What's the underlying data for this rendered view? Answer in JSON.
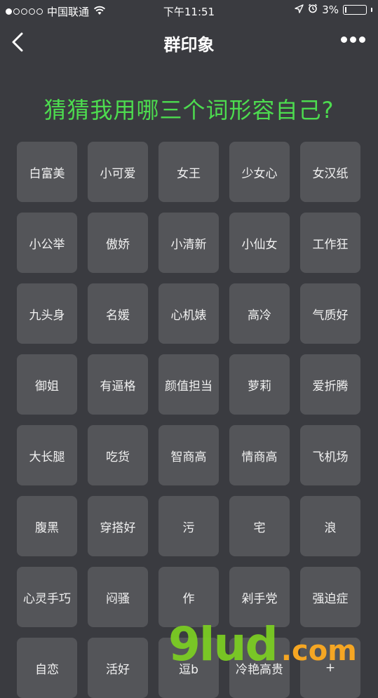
{
  "status_bar": {
    "carrier": "中国联通",
    "time": "下午11:51",
    "battery": "3%",
    "signal_bars_filled": 1,
    "signal_bars_total": 5
  },
  "nav": {
    "title": "群印象",
    "back_icon": "chevron-left-icon",
    "more_icon": "more-dots-icon"
  },
  "question": "猜猜我用哪三个词形容自己?",
  "tags": [
    "白富美",
    "小可爱",
    "女王",
    "少女心",
    "女汉纸",
    "小公举",
    "傲娇",
    "小清新",
    "小仙女",
    "工作狂",
    "九头身",
    "名媛",
    "心机婊",
    "高冷",
    "气质好",
    "御姐",
    "有逼格",
    "颜值担当",
    "萝莉",
    "爱折腾",
    "大长腿",
    "吃货",
    "智商高",
    "情商高",
    "飞机场",
    "腹黑",
    "穿搭好",
    "污",
    "宅",
    "浪",
    "心灵手巧",
    "闷骚",
    "作",
    "剁手党",
    "强迫症",
    "自恋",
    "活好",
    "逗b",
    "冷艳高贵",
    "+"
  ],
  "watermark": {
    "main": "9lud",
    "tld": ".com"
  },
  "colors": {
    "background": "#3a3b40",
    "tile": "#545559",
    "question": "#4ddc4f",
    "watermark_green": "#7ed321",
    "watermark_orange": "#f5a623"
  }
}
